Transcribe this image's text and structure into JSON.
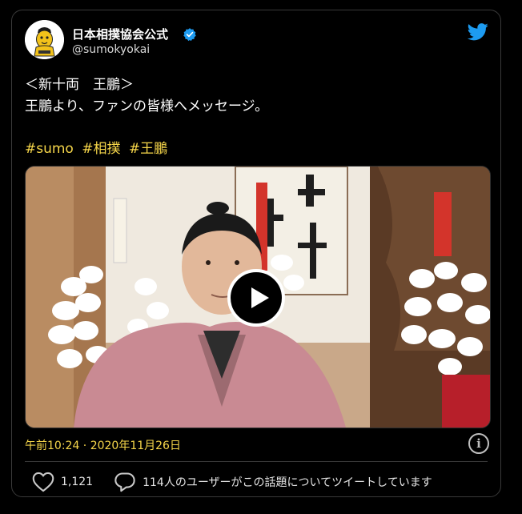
{
  "account": {
    "display_name": "日本相撲協会公式",
    "handle": "@sumokyokai",
    "verified": true
  },
  "tweet": {
    "lines": [
      "＜新十両　王鵬＞",
      "王鵬より、ファンの皆様へメッセージ。"
    ],
    "hashtags": [
      "#sumo",
      "#相撲",
      "#王鵬"
    ],
    "timestamp": "午前10:24 · 2020年11月26日"
  },
  "media": {
    "type": "video",
    "play_icon": "play-icon"
  },
  "actions": {
    "likes": "1,121",
    "conversation": "114人のユーザーがこの話題についてツイートしています"
  },
  "colors": {
    "background": "#000000",
    "accent": "#f6d64a",
    "twitter_blue": "#1d9bf0"
  }
}
